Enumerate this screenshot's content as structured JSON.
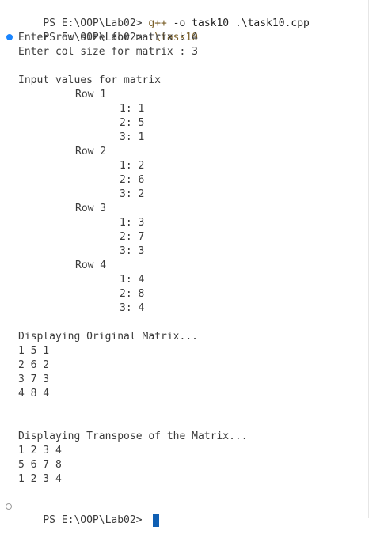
{
  "terminal": {
    "commands": [
      {
        "prompt": "PS E:\\OOP\\Lab02> ",
        "cmd": "g++",
        "args": " -o task10 .\\task10.cpp"
      },
      {
        "prompt": "PS E:\\OOP\\Lab02> ",
        "cmd": ".\\task10",
        "args": ""
      }
    ],
    "output": {
      "row_prompt": "Enter row size for matrix : 4",
      "col_prompt": "Enter col size for matrix : 3",
      "input_header": "Input values for matrix",
      "rows": [
        {
          "label": "Row 1",
          "values": [
            "1: 1",
            "2: 5",
            "3: 1"
          ]
        },
        {
          "label": "Row 2",
          "values": [
            "1: 2",
            "2: 6",
            "3: 2"
          ]
        },
        {
          "label": "Row 3",
          "values": [
            "1: 3",
            "2: 7",
            "3: 3"
          ]
        },
        {
          "label": "Row 4",
          "values": [
            "1: 4",
            "2: 8",
            "3: 4"
          ]
        }
      ],
      "original_header": "Displaying Original Matrix...",
      "original_matrix": [
        "1 5 1",
        "2 6 2",
        "3 7 3",
        "4 8 4"
      ],
      "transpose_header": "Displaying Transpose of the Matrix...",
      "transpose_matrix": [
        "1 2 3 4",
        "5 6 7 8",
        "1 2 3 4"
      ]
    },
    "final_prompt": "PS E:\\OOP\\Lab02> "
  },
  "colors": {
    "command": "#795e26",
    "text": "#3b3b3b",
    "success_dot": "#1a85ff",
    "cursor": "#0f5fb3"
  }
}
